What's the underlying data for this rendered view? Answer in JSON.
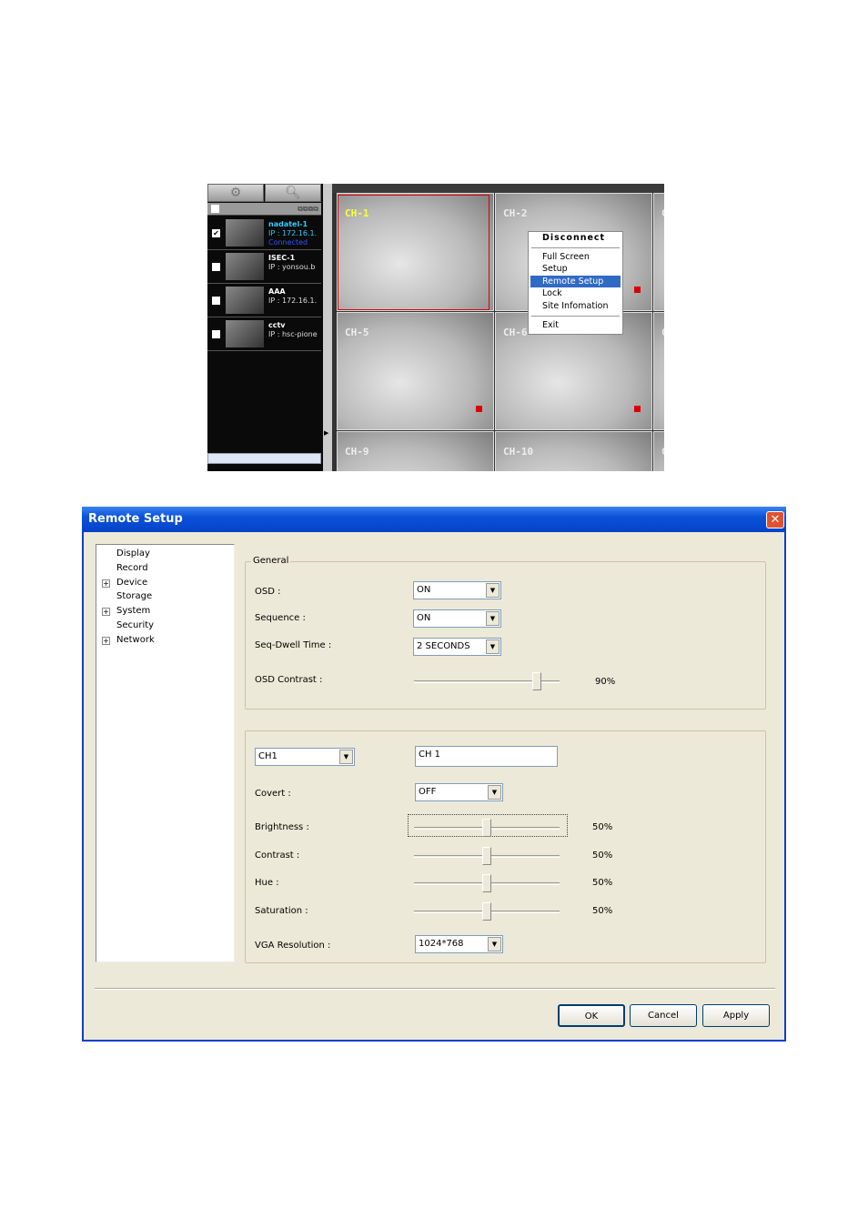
{
  "client": {
    "toolbar": {
      "settings_icon": "gear-icon",
      "search_icon": "magnifier-icon",
      "tools_label": "⧉⧉⧉⧉"
    },
    "sites": [
      {
        "name": "nadatel-1",
        "ip": "IP : 172.16.1.",
        "status": "Connected",
        "checked": true
      },
      {
        "name": "ISEC-1",
        "ip": "IP : yonsou.b",
        "status": "",
        "checked": false
      },
      {
        "name": "AAA",
        "ip": "IP : 172.16.1.",
        "status": "",
        "checked": false
      },
      {
        "name": "cctv",
        "ip": "IP : hsc-pione",
        "status": "",
        "checked": false
      }
    ],
    "channels": [
      "CH-1",
      "CH-2",
      "C",
      "CH-5",
      "CH-6",
      "C",
      "CH-9",
      "CH-10",
      "C"
    ],
    "context_menu": {
      "items": [
        "Disconnect",
        "Full Screen",
        "Setup",
        "Remote Setup",
        "Lock",
        "Site Infomation",
        "Exit"
      ],
      "highlighted": "Remote Setup"
    }
  },
  "dialog": {
    "title": "Remote Setup",
    "tree": [
      {
        "label": "Display",
        "expandable": false
      },
      {
        "label": "Record",
        "expandable": false
      },
      {
        "label": "Device",
        "expandable": true
      },
      {
        "label": "Storage",
        "expandable": false
      },
      {
        "label": "System",
        "expandable": true
      },
      {
        "label": "Security",
        "expandable": false
      },
      {
        "label": "Network",
        "expandable": true
      }
    ],
    "general": {
      "title": "General",
      "osd_label": "OSD :",
      "osd": "ON",
      "sequence_label": "Sequence :",
      "sequence": "ON",
      "dwell_label": "Seq-Dwell Time :",
      "dwell": "2 SECONDS",
      "contrast_label": "OSD Contrast :",
      "contrast": "90%",
      "contrast_value": 90
    },
    "channel": {
      "channel_select": "CH1",
      "channel_name": "CH 1",
      "covert_label": "Covert :",
      "covert": "OFF",
      "sliders": [
        {
          "label": "Brightness :",
          "value": "50%"
        },
        {
          "label": "Contrast :",
          "value": "50%"
        },
        {
          "label": "Hue :",
          "value": "50%"
        },
        {
          "label": "Saturation :",
          "value": "50%"
        }
      ],
      "vga_label": "VGA Resolution :",
      "vga": "1024*768"
    },
    "buttons": {
      "ok": "OK",
      "cancel": "Cancel",
      "apply": "Apply"
    }
  }
}
